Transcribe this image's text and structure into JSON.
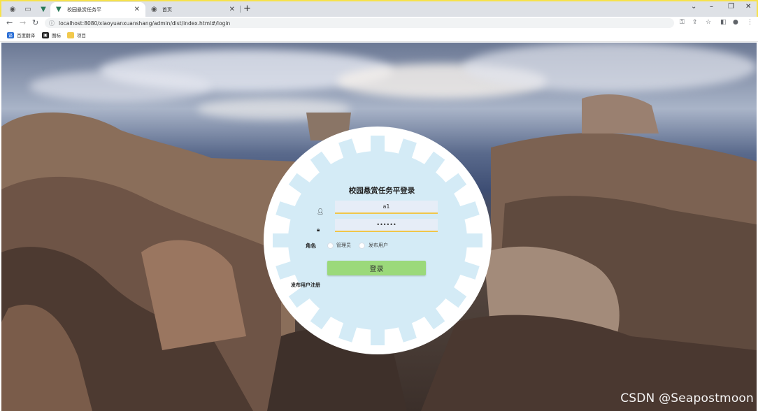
{
  "browser": {
    "tabs": [
      {
        "title": "校园悬赏任务平",
        "active": true
      },
      {
        "title": "首页",
        "active": false
      }
    ],
    "new_tab": "+",
    "window_controls": {
      "down": "⌄",
      "minimize": "–",
      "restore": "❐",
      "close": "✕"
    },
    "address": "localhost:8080/xiaoyuanxuanshang/admin/dist/index.html#/login",
    "bookmarks": [
      "百度翻译",
      "图标",
      "项目"
    ]
  },
  "login": {
    "title": "校园悬赏任务平登录",
    "username_value": "a1",
    "password_value": "••••••",
    "role_label": "角色",
    "roles": [
      "管理员",
      "发布用户"
    ],
    "submit_label": "登录",
    "register_link": "发布用户注册"
  },
  "watermark": "CSDN @Seapostmoon",
  "colors": {
    "card_bg": "#d4ebf6",
    "gear_white": "#ffffff",
    "button_green": "#9bd97a",
    "input_underline": "#f0c64a"
  },
  "icons": {
    "user": "user-icon",
    "lock": "lock-icon"
  }
}
